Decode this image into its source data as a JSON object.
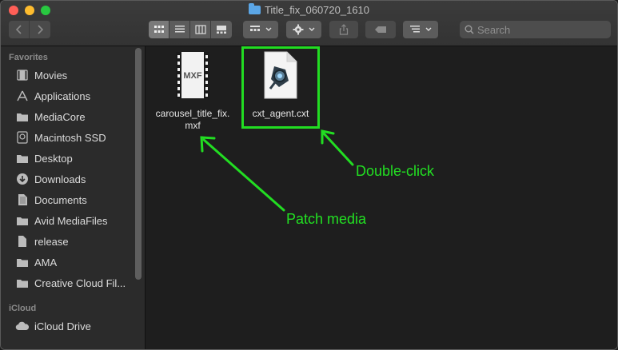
{
  "window": {
    "title": "Title_fix_060720_1610"
  },
  "search": {
    "placeholder": "Search"
  },
  "sidebar": {
    "favorites_title": "Favorites",
    "favorites": [
      {
        "label": "Movies",
        "icon": "film-icon"
      },
      {
        "label": "Applications",
        "icon": "applications-icon"
      },
      {
        "label": "MediaCore",
        "icon": "folder-icon"
      },
      {
        "label": "Macintosh SSD",
        "icon": "hard-drive-icon"
      },
      {
        "label": "Desktop",
        "icon": "desktop-icon"
      },
      {
        "label": "Downloads",
        "icon": "download-icon"
      },
      {
        "label": "Documents",
        "icon": "document-icon"
      },
      {
        "label": "Avid MediaFiles",
        "icon": "folder-icon"
      },
      {
        "label": "release",
        "icon": "file-icon"
      },
      {
        "label": "AMA",
        "icon": "folder-icon"
      },
      {
        "label": "Creative Cloud Fil...",
        "icon": "folder-icon"
      }
    ],
    "icloud_title": "iCloud",
    "icloud": [
      {
        "label": "iCloud Drive",
        "icon": "cloud-icon"
      }
    ]
  },
  "files": [
    {
      "name_line1": "carousel_title_fix.",
      "name_line2": "mxf",
      "icon": "mxf-video-icon",
      "icon_text": "MXF"
    },
    {
      "name_line1": "cxt_agent.cxt",
      "icon": "cxt-document-icon"
    }
  ],
  "annotations": {
    "double_click": "Double-click",
    "patch_media": "Patch media",
    "color": "#22e022"
  }
}
